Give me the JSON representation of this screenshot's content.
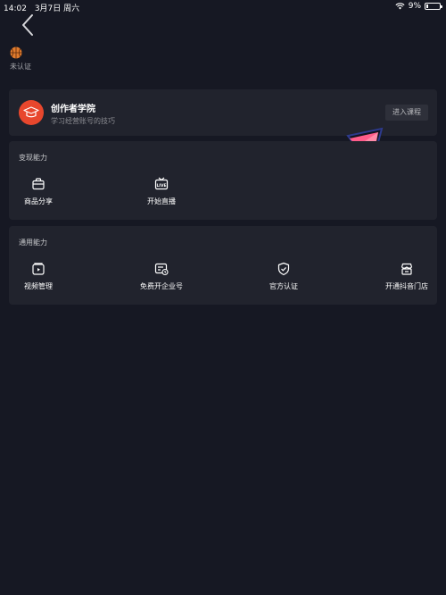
{
  "status_bar": {
    "time": "14:02",
    "date": "3月7日 周六",
    "battery": "9%",
    "battery_level": 0.09
  },
  "profile": {
    "badge_icon": "basketball-icon",
    "status": "未认证"
  },
  "academy": {
    "title": "创作者学院",
    "subtitle": "学习经营账号的技巧",
    "button": "进入课程",
    "logo_icon": "graduation-cap-icon",
    "accent": "#e8472d"
  },
  "monetize": {
    "title": "变现能力",
    "items": [
      {
        "label": "商品分享",
        "icon": "shopping-bag-icon"
      },
      {
        "label": "开始直播",
        "icon": "live-tv-icon"
      }
    ]
  },
  "general": {
    "title": "通用能力",
    "items": [
      {
        "label": "视频管理",
        "icon": "video-folder-icon"
      },
      {
        "label": "免费开企业号",
        "icon": "enterprise-card-icon"
      },
      {
        "label": "官方认证",
        "icon": "shield-check-icon"
      },
      {
        "label": "开通抖音门店",
        "icon": "store-icon"
      }
    ]
  },
  "colors": {
    "background": "#161823",
    "card": "#21232d",
    "accent_pink": "#ff5c8a"
  }
}
